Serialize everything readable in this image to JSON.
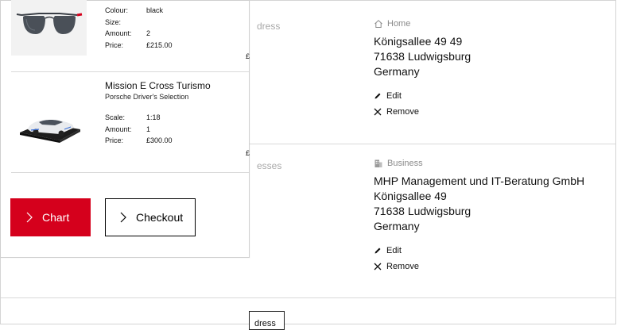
{
  "address_page": {
    "sections": [
      {
        "label_fragment": "dress",
        "type_icon": "home-icon",
        "type_label": "Home",
        "lines": [
          "Königsallee 49 49",
          "71638 Ludwigsburg",
          "Germany"
        ],
        "edit_label": "Edit",
        "remove_label": "Remove"
      },
      {
        "label_fragment": "esses",
        "type_icon": "building-icon",
        "type_label": "Business",
        "lines": [
          "MHP Management und IT-Beratung GmbH",
          "Königsallee 49",
          "71638 Ludwigsburg",
          "Germany"
        ],
        "edit_label": "Edit",
        "remove_label": "Remove"
      }
    ],
    "bottom_button_fragment": "dress"
  },
  "cart": {
    "items": [
      {
        "image": "sunglasses",
        "specs": [
          {
            "key": "Colour:",
            "value": "black"
          },
          {
            "key": "Size:",
            "value": ""
          },
          {
            "key": "Amount:",
            "value": "2"
          },
          {
            "key": "Price:",
            "value": "£215.00"
          }
        ],
        "edge_price_fragment": "£"
      },
      {
        "image": "model-car",
        "title": "Mission E Cross Turismo",
        "subtitle": "Porsche Driver's Selection",
        "specs": [
          {
            "key": "Scale:",
            "value": "1:18"
          },
          {
            "key": "Amount:",
            "value": "1"
          },
          {
            "key": "Price:",
            "value": "£300.00"
          }
        ],
        "edge_price_fragment": "£"
      }
    ],
    "buttons": {
      "primary_label": "Chart",
      "secondary_label": "Checkout"
    }
  },
  "colors": {
    "primary": "#d5001c",
    "divider": "#d9d9d9",
    "muted_text": "#a8a8a8"
  }
}
